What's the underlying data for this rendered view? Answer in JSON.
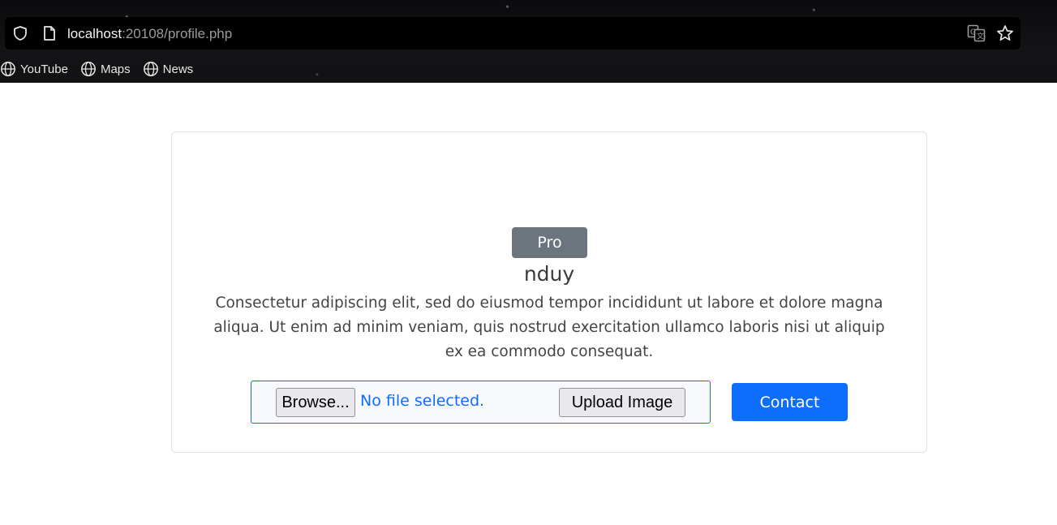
{
  "browser": {
    "url_host": "localhost",
    "url_rest": ":20108/profile.php",
    "icons": {
      "security": "shield-icon",
      "page": "page-icon",
      "translate": "translate-icon",
      "bookmark_star": "star-icon",
      "bookmark_item": "globe-icon"
    },
    "bookmarks": [
      {
        "label": "YouTube"
      },
      {
        "label": "Maps"
      },
      {
        "label": "News"
      }
    ]
  },
  "profile": {
    "badge": "Pro",
    "username": "nduy",
    "bio": "Consectetur adipiscing elit, sed do eiusmod tempor incididunt ut labore et dolore magna aliqua. Ut enim ad minim veniam, quis nostrud exercitation ullamco laboris nisi ut aliquip ex ea commodo consequat."
  },
  "upload": {
    "browse_label": "Browse...",
    "file_status": "No file selected.",
    "upload_label": "Upload Image"
  },
  "actions": {
    "contact_label": "Contact"
  },
  "colors": {
    "primary": "#0d6efd",
    "badge": "#6c757d",
    "chrome_bg": "#111113"
  }
}
